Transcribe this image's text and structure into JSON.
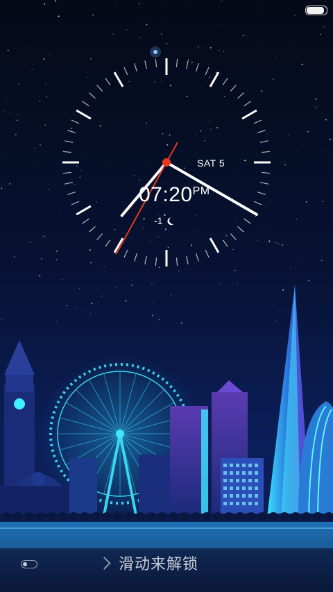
{
  "status": {
    "battery_level": 0.9
  },
  "lockscreen": {
    "date": "SAT 5",
    "time": "07:20",
    "ampm": "PM",
    "temperature": "-1",
    "degree_symbol": "°",
    "weather_icon": "moon-icon",
    "unlock_text": "滑动来解锁"
  },
  "colors": {
    "second_hand": "#e8391d",
    "clock_face": "#ffffff",
    "sky": "#060d22",
    "city_glow": "#2bd3ff"
  }
}
